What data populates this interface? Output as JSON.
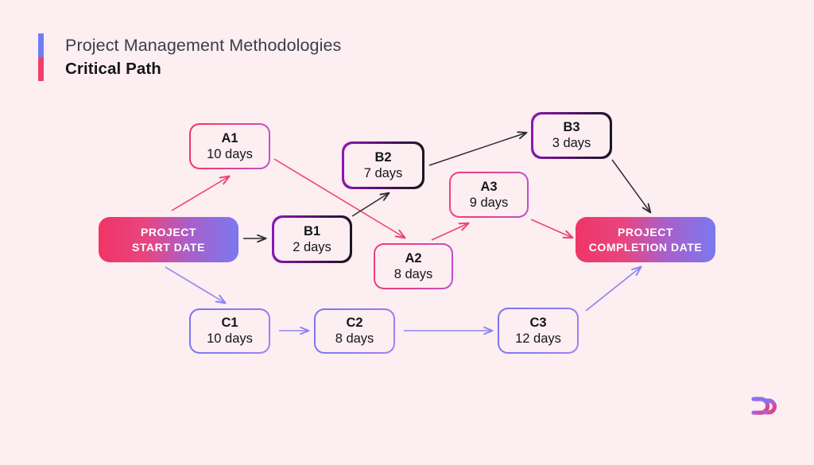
{
  "header": {
    "title": "Project Management Methodologies",
    "subtitle": "Critical Path",
    "bar_top_color": "#6e7ef2",
    "bar_bottom_color": "#ef3f6b"
  },
  "canvas": {
    "background": "#fceef1"
  },
  "diagram": {
    "type": "critical-path-network",
    "start_node": {
      "line1": "PROJECT",
      "line2": "START DATE",
      "gradient_from": "#ef3566",
      "gradient_to": "#7b78ef"
    },
    "end_node": {
      "line1": "PROJECT",
      "line2": "COMPLETION DATE",
      "gradient_from": "#ef3566",
      "gradient_to": "#7b78ef"
    },
    "tasks": [
      {
        "id": "A1",
        "code": "A1",
        "duration": "10 days",
        "track": "A",
        "border": "pink"
      },
      {
        "id": "A2",
        "code": "A2",
        "duration": "8 days",
        "track": "A",
        "border": "pink"
      },
      {
        "id": "A3",
        "code": "A3",
        "duration": "9 days",
        "track": "A",
        "border": "pink"
      },
      {
        "id": "B1",
        "code": "B1",
        "duration": "2 days",
        "track": "B",
        "border": "purple"
      },
      {
        "id": "B2",
        "code": "B2",
        "duration": "7 days",
        "track": "B",
        "border": "purple"
      },
      {
        "id": "B3",
        "code": "B3",
        "duration": "3 days",
        "track": "B",
        "border": "purple"
      },
      {
        "id": "C1",
        "code": "C1",
        "duration": "10 days",
        "track": "C",
        "border": "blue"
      },
      {
        "id": "C2",
        "code": "C2",
        "duration": "8 days",
        "track": "C",
        "border": "blue"
      },
      {
        "id": "C3",
        "code": "C3",
        "duration": "12 days",
        "track": "C",
        "border": "blue"
      }
    ],
    "edges": [
      {
        "from": "START",
        "to": "A1",
        "color": "#ef4473"
      },
      {
        "from": "START",
        "to": "B1",
        "color": "#2d2d34"
      },
      {
        "from": "START",
        "to": "C1",
        "color": "#8b85ef"
      },
      {
        "from": "A1",
        "to": "A2",
        "color": "#ef4473"
      },
      {
        "from": "A2",
        "to": "A3",
        "color": "#ef4473"
      },
      {
        "from": "A3",
        "to": "END",
        "color": "#ef4473"
      },
      {
        "from": "B1",
        "to": "B2",
        "color": "#2d2d34"
      },
      {
        "from": "B2",
        "to": "B3",
        "color": "#2d2d34"
      },
      {
        "from": "B3",
        "to": "END",
        "color": "#2d2d34"
      },
      {
        "from": "C1",
        "to": "C2",
        "color": "#8b85ef"
      },
      {
        "from": "C2",
        "to": "C3",
        "color": "#8b85ef"
      },
      {
        "from": "C3",
        "to": "END",
        "color": "#8b85ef"
      }
    ],
    "track_colors": {
      "A": "#ef4473",
      "B": "#2d2d34",
      "C": "#8b85ef"
    }
  },
  "logo": {
    "name": "brand-logo",
    "gradient_from": "#7b78ef",
    "gradient_to": "#ef3566"
  }
}
